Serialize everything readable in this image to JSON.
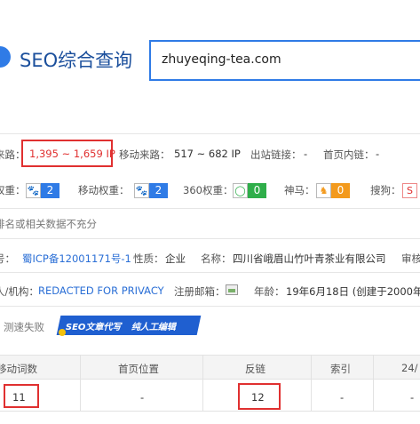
{
  "header": {
    "site_title": "SEO综合查询",
    "search_value": "zhuyeqing-tea.com"
  },
  "traffic": {
    "label_pc": "来路：",
    "pc_value": "1,395 ~ 1,659 IP",
    "label_mobile": "移动来路：",
    "mobile_value": "517 ~ 682 IP",
    "label_outbound": "出站链接：",
    "outbound_value": "-",
    "label_home_inbound": "首页内链：",
    "home_inbound_value": "-"
  },
  "weights": {
    "label_baidu": "权重：",
    "baidu_value": "2",
    "label_mobile": "移动权重：",
    "mobile_value": "2",
    "label_360": "360权重：",
    "w360_value": "0",
    "label_shenma": "神马：",
    "shenma_value": "0",
    "label_sogou": "搜狗：",
    "colors": {
      "baidu": "#2f7be6",
      "mobile": "#2f7be6",
      "w360": "#2fae4a",
      "shenma": "#f39a1d"
    }
  },
  "notice": "排名或相关数据不充分",
  "icp": {
    "label_icp": "号：",
    "icp_value": "蜀ICP备12001171号-1",
    "label_nature": "性质：",
    "nature_value": "企业",
    "label_name": "名称：",
    "name_value": "四川省峨眉山竹叶青茶业有限公司",
    "label_review": "审核"
  },
  "whois": {
    "label_org": "人/机构：",
    "org_value": "REDACTED FOR PRIVACY",
    "label_email": "注册邮箱：",
    "label_age": "年龄：",
    "age_value": "19年6月18日 (创建于2000年"
  },
  "speed": {
    "label": "测速失败",
    "tag1": "SEO文章代写",
    "tag2": "纯人工编辑"
  },
  "table": {
    "headers": [
      "移动词数",
      "首页位置",
      "反链",
      "索引",
      "24/"
    ],
    "values": [
      "11",
      "-",
      "12",
      "-",
      "-"
    ]
  }
}
